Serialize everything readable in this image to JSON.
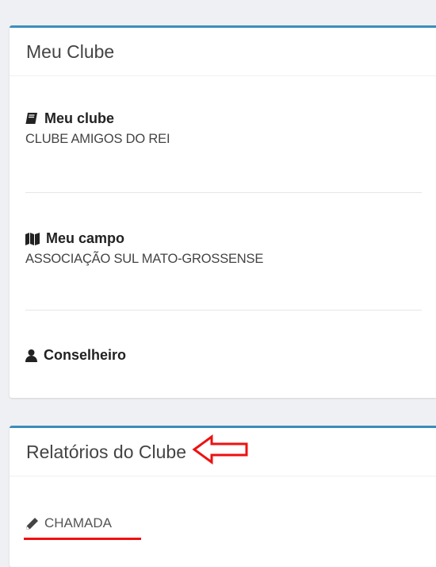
{
  "club_card": {
    "title": "Meu Clube",
    "items": [
      {
        "icon": "book-icon",
        "label": "Meu clube",
        "value": "CLUBE AMIGOS DO REI"
      },
      {
        "icon": "map-icon",
        "label": "Meu campo",
        "value": "ASSOCIAÇÃO SUL MATO-GROSSENSE"
      },
      {
        "icon": "user-icon",
        "label": "Conselheiro",
        "value": ""
      }
    ]
  },
  "reports_card": {
    "title": "Relatórios do Clube",
    "link_label": "CHAMADA",
    "link_icon": "pencil-icon",
    "annotation_color": "#ee1111"
  },
  "accent_color": "#3c8dbc"
}
